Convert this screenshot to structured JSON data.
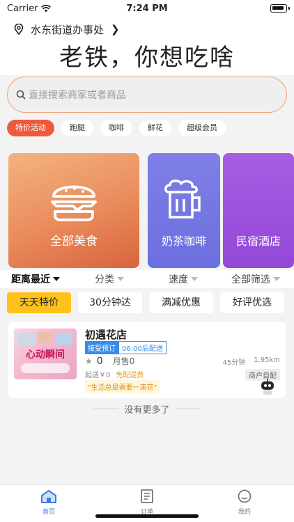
{
  "status_bar": {
    "carrier": "Carrier",
    "time": "7:24 PM"
  },
  "location": {
    "name": "水东街道办事处"
  },
  "hero": {
    "text": "老铁，你想吃啥"
  },
  "search": {
    "placeholder": "直接搜索商家或者商品"
  },
  "chips": [
    {
      "label": "特价活动",
      "active": true
    },
    {
      "label": "跑腿"
    },
    {
      "label": "咖啡"
    },
    {
      "label": "鲜花"
    },
    {
      "label": "超级会员"
    }
  ],
  "banners": [
    {
      "label": "全部美食",
      "icon": "burger-icon"
    },
    {
      "label": "奶茶咖啡",
      "icon": "beer-mug-icon"
    },
    {
      "label": "民宿酒店",
      "icon": ""
    }
  ],
  "filters": [
    {
      "label": "距离最近",
      "active": true
    },
    {
      "label": "分类"
    },
    {
      "label": "速度"
    },
    {
      "label": "全部筛选"
    }
  ],
  "tags": [
    {
      "label": "天天特价",
      "active": true
    },
    {
      "label": "30分钟达"
    },
    {
      "label": "满减优惠"
    },
    {
      "label": "好评优选"
    }
  ],
  "store": {
    "name": "初遇花店",
    "badge_pre": "接受预订",
    "badge_time": "06:00后配送",
    "rating": "0",
    "monthly_sales": "月售0",
    "delivery_time": "45分钟",
    "distance": "1.95km",
    "min_order": "起送￥0",
    "delivery_fee": "免配送费",
    "self_pick": "商户自配",
    "slogan": "\"生活总是需要一束花\"",
    "image_text": "心动瞬间"
  },
  "list_footer": "没有更多了",
  "tab_bar": [
    {
      "label": "首页",
      "icon": "home-icon",
      "active": true
    },
    {
      "label": "订单",
      "icon": "order-icon"
    },
    {
      "label": "我的",
      "icon": "profile-icon"
    }
  ],
  "colors": {
    "accent": "#ee5a3c",
    "tag_active": "#ffc21a",
    "tab_active": "#3f7be0",
    "badge_blue": "#3a8be8"
  }
}
